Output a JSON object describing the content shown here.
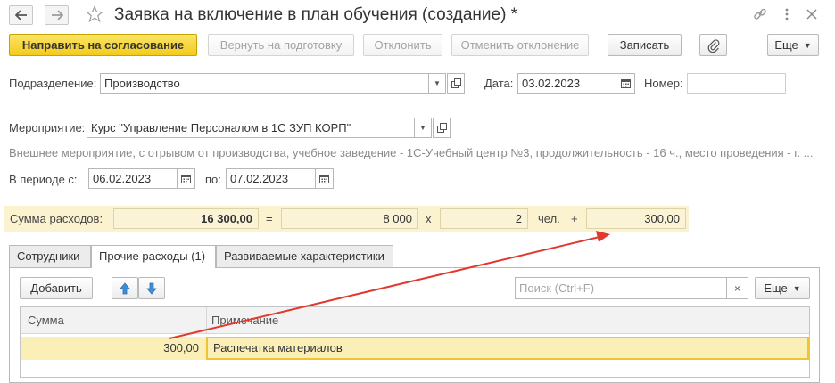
{
  "window": {
    "title": "Заявка на включение в план обучения (создание) *"
  },
  "toolbar": {
    "send_label": "Направить на согласование",
    "return_label": "Вернуть на подготовку",
    "reject_label": "Отклонить",
    "cancel_reject_label": "Отменить отклонение",
    "save_label": "Записать",
    "more_label": "Еще"
  },
  "header": {
    "department_label": "Подразделение:",
    "department_value": "Производство",
    "date_label": "Дата:",
    "date_value": "03.02.2023",
    "number_label": "Номер:",
    "number_value": ""
  },
  "event": {
    "label": "Мероприятие:",
    "value": "Курс \"Управление Персоналом в 1С ЗУП КОРП\"",
    "description": "Внешнее мероприятие, с отрывом от производства, учебное заведение - 1С-Учебный центр №3, продолжительность - 16 ч., место проведения - г. ..."
  },
  "period": {
    "from_label": "В периоде с:",
    "from_value": "06.02.2023",
    "to_label": "по:",
    "to_value": "07.02.2023"
  },
  "expenses": {
    "label": "Сумма расходов:",
    "total": "16 300,00",
    "eq": "=",
    "per_person": "8 000",
    "times": "x",
    "count": "2",
    "count_unit": "чел.",
    "plus": "+",
    "other": "300,00"
  },
  "tabs": [
    {
      "label": "Сотрудники",
      "active": false
    },
    {
      "label": "Прочие расходы (1)",
      "active": true
    },
    {
      "label": "Развиваемые характеристики",
      "active": false
    }
  ],
  "table_toolbar": {
    "add_label": "Добавить",
    "search_placeholder": "Поиск (Ctrl+F)",
    "clear_label": "×",
    "more_label": "Еще"
  },
  "table": {
    "columns": [
      "Сумма",
      "Примечание"
    ],
    "rows": [
      {
        "sum": "300,00",
        "note": "Распечатка материалов"
      }
    ]
  },
  "icons": {
    "back": "arrow-left-icon",
    "forward": "arrow-right-icon",
    "favorite": "star-icon",
    "link": "link-icon",
    "menu": "more-vert-icon",
    "close": "close-icon",
    "attach": "paperclip-icon",
    "calendar": "calendar-icon",
    "open": "open-form-icon",
    "dropdown": "chevron-down-icon",
    "move_up": "arrow-up-icon",
    "move_down": "arrow-down-icon"
  },
  "colors": {
    "primary_button": "#f2cb1b",
    "sum_panel": "#fbf3cf",
    "selected_row": "#fbefb8",
    "selected_border": "#f1c232",
    "annotation_arrow": "#e03a2f"
  }
}
